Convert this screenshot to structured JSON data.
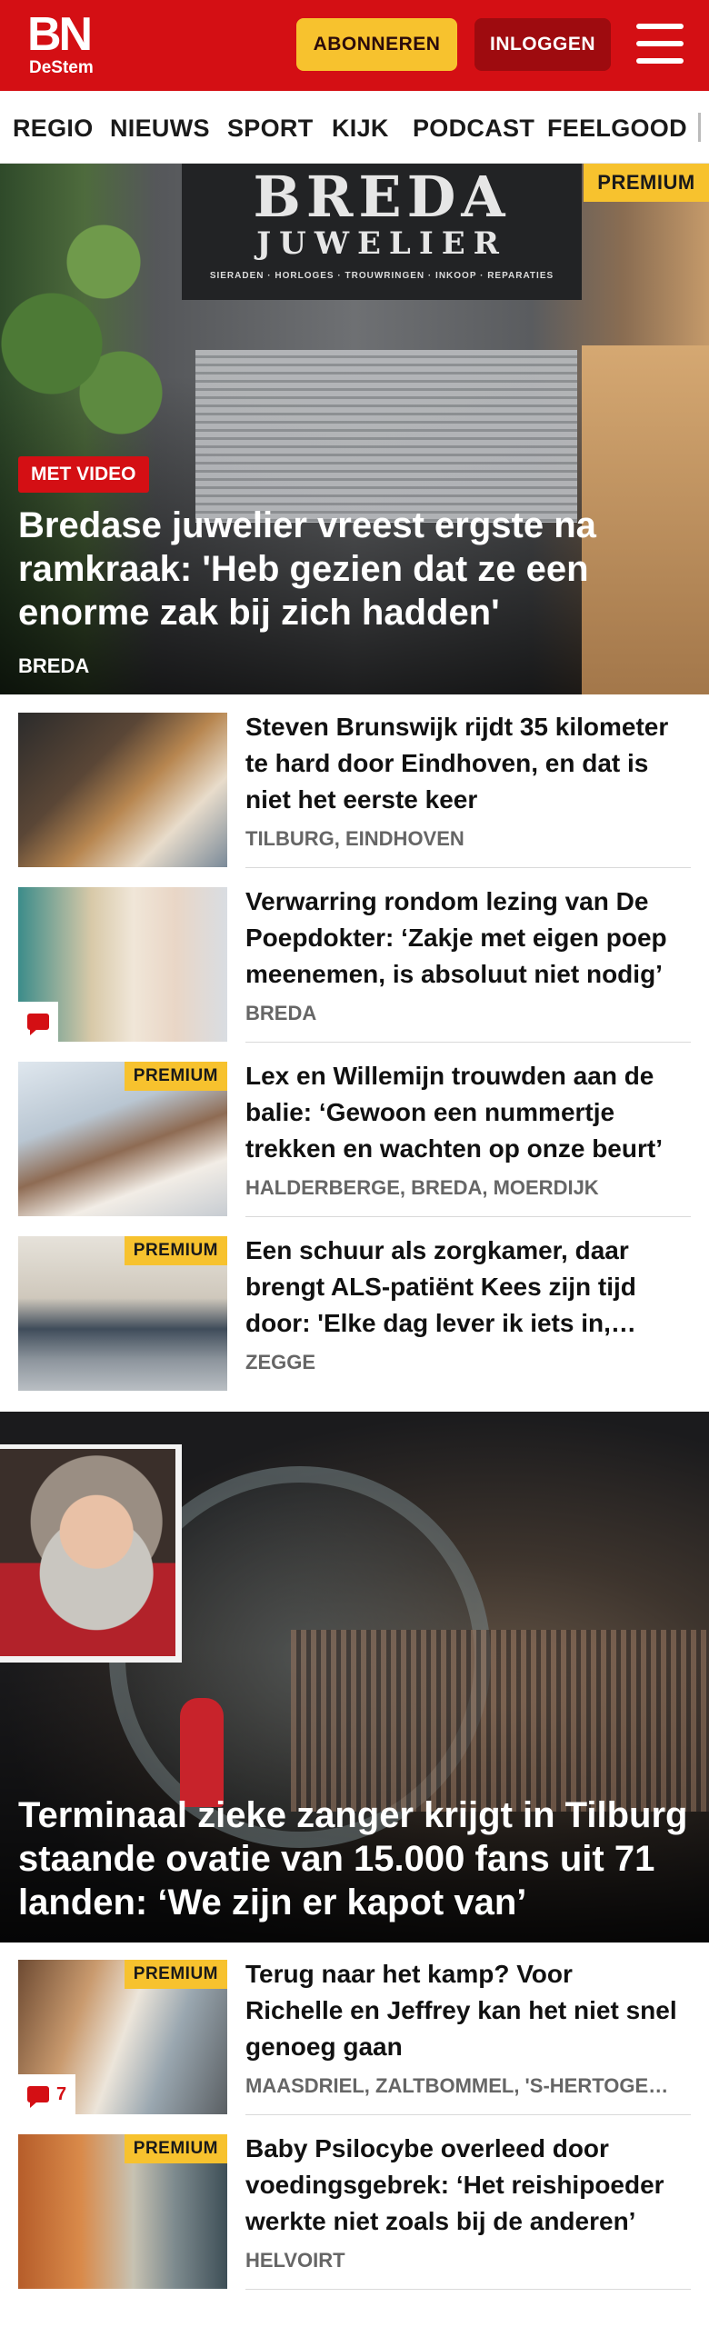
{
  "header": {
    "logo_top": "BN",
    "logo_bottom": "DeStem",
    "subscribe_label": "ABONNEREN",
    "login_label": "INLOGGEN"
  },
  "nav": {
    "items": [
      "REGIO",
      "NIEUWS",
      "SPORT",
      "KIJK",
      "PODCAST",
      "FEELGOOD"
    ]
  },
  "hero": {
    "sign_line1": "BREDA",
    "sign_line2": "JUWELIER",
    "sign_line3": "SIERADEN · HORLOGES · TROUWRINGEN · INKOOP · REPARATIES",
    "premium": "PREMIUM",
    "video_label": "MET VIDEO",
    "title": "Bredase juwelier vreest ergste na ramkraak: 'Heb gezien dat ze een enorme zak bij zich hadden'",
    "tag": "BREDA"
  },
  "articles": [
    {
      "title": "Steven Brunswijk rijdt 35 kilometer te hard door Eindhoven, en dat is niet het eerste keer",
      "tags": "TILBURG, EINDHOVEN",
      "premium": "",
      "comments": ""
    },
    {
      "title": "Verwarring rondom lezing van De Poepdokter: ‘Zakje met eigen poep meenemen, is absoluut niet nodig’",
      "tags": "BREDA",
      "premium": "",
      "comments": ""
    },
    {
      "title": "Lex en Willemijn trouwden aan de balie: ‘Gewoon een nummertje trekken en wachten op onze beurt’",
      "tags": "HALDERBERGE, BREDA, MOERDIJK",
      "premium": "PREMIUM",
      "comments": ""
    },
    {
      "title": "Een schuur als zorgkamer, daar brengt ALS-patiënt Kees zijn tijd door: 'Elke dag lever ik iets in, maar'",
      "tags": "ZEGGE",
      "premium": "PREMIUM",
      "comments": ""
    }
  ],
  "hero2": {
    "title": "Terminaal zieke zanger krijgt in Tilburg staande ovatie van 15.000 fans uit 71 landen: ‘We zijn er kapot van’"
  },
  "articles2": [
    {
      "title": "Terug naar het kamp? Voor Richelle en Jeffrey kan het niet snel genoeg gaan",
      "tags": "MAASDRIEL, ZALTBOMMEL, 'S-HERTOGENBOSCH",
      "premium": "PREMIUM",
      "comments": "7"
    },
    {
      "title": "Baby Psilocybe overleed door voedingsgebrek: ‘Het reishipoe­der werkte niet zoals bij de anderen’",
      "tags": "HELVOIRT",
      "premium": "PREMIUM",
      "comments": ""
    }
  ],
  "colors": {
    "brand_red": "#d40f14",
    "premium_yellow": "#f7c22e",
    "login_dark_red": "#9e0b0f"
  }
}
